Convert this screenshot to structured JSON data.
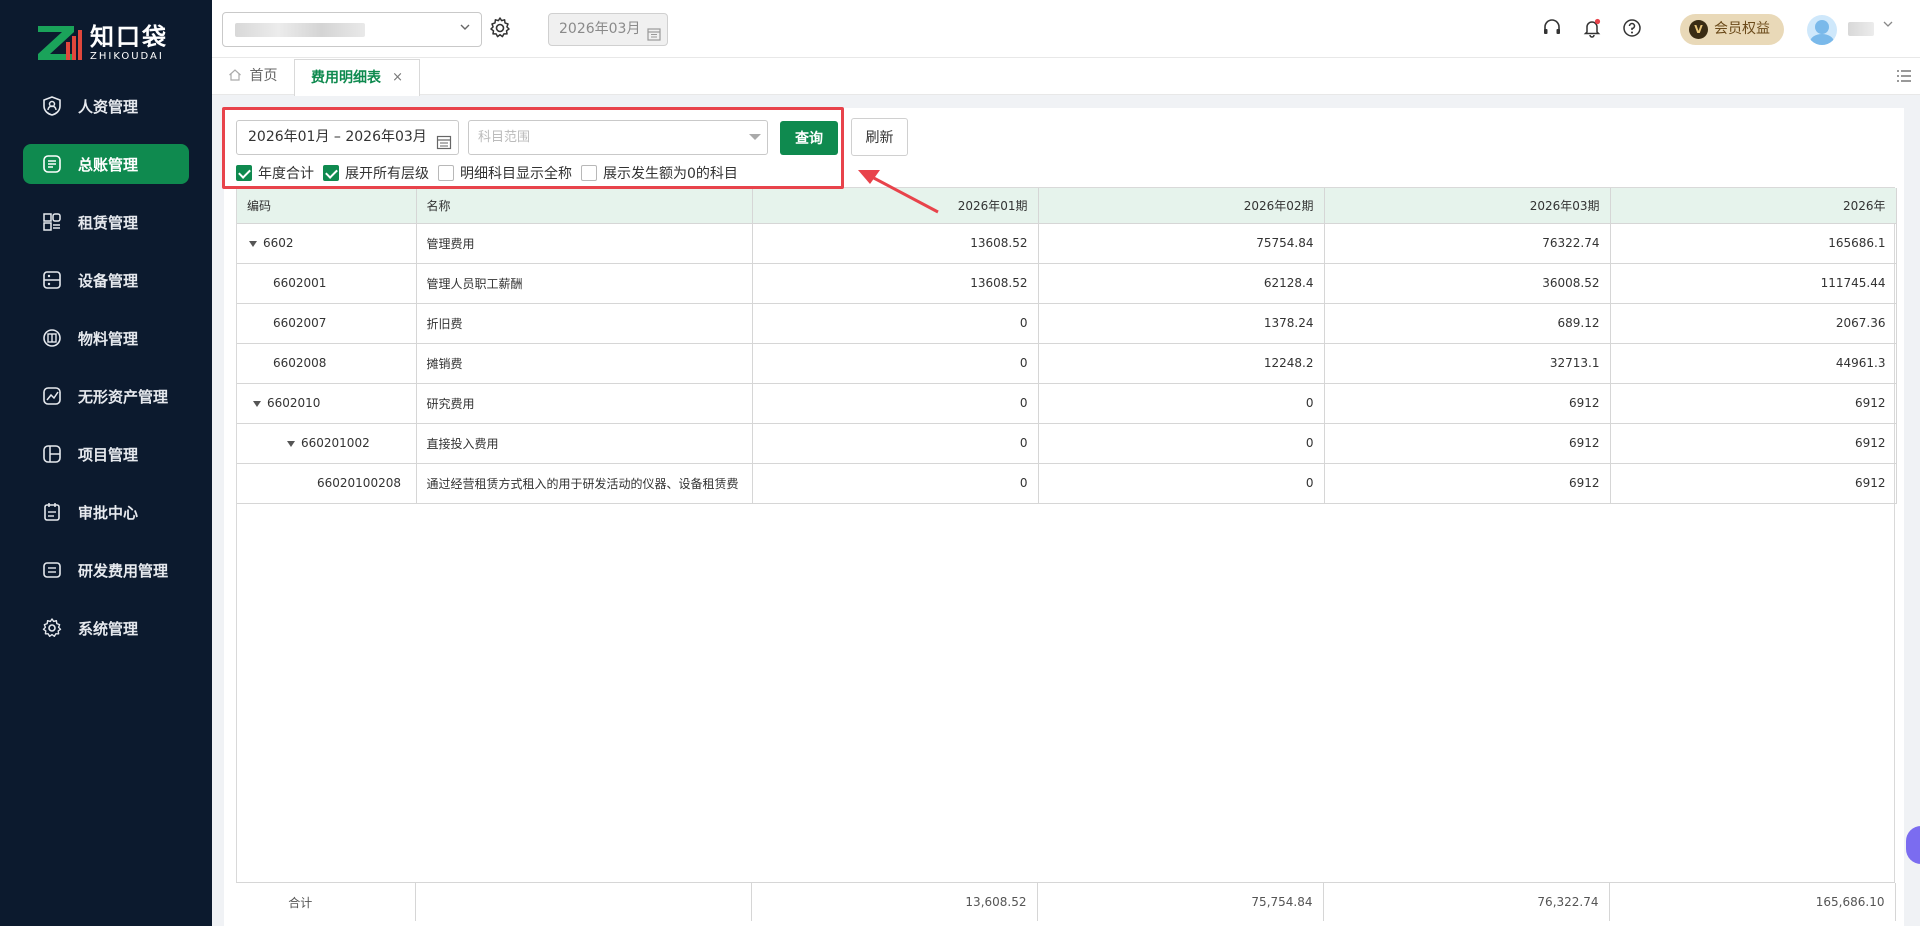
{
  "brand": {
    "name_cn": "知口袋",
    "name_en": "ZHIKOUDAI"
  },
  "sidebar": {
    "items": [
      {
        "label": "人资管理",
        "icon": "person-badge-icon",
        "active": false
      },
      {
        "label": "总账管理",
        "icon": "ledger-icon",
        "active": true
      },
      {
        "label": "租赁管理",
        "icon": "lease-icon",
        "active": false
      },
      {
        "label": "设备管理",
        "icon": "device-icon",
        "active": false
      },
      {
        "label": "物料管理",
        "icon": "material-icon",
        "active": false
      },
      {
        "label": "无形资产管理",
        "icon": "intangible-asset-icon",
        "active": false
      },
      {
        "label": "项目管理",
        "icon": "project-icon",
        "active": false
      },
      {
        "label": "审批中心",
        "icon": "approval-icon",
        "active": false
      },
      {
        "label": "研发费用管理",
        "icon": "rd-expense-icon",
        "active": false
      },
      {
        "label": "系统管理",
        "icon": "gear-icon",
        "active": false
      }
    ]
  },
  "header": {
    "current_month": "2026年03月",
    "vip_label": "会员权益",
    "vip_badge": "V"
  },
  "tabs": {
    "home": "首页",
    "active": "费用明细表",
    "close": "×"
  },
  "filter": {
    "date_range": "2026年01月 – 2026年03月",
    "subject_placeholder": "科目范围",
    "query_label": "查询",
    "refresh_label": "刷新",
    "checkboxes": [
      {
        "label": "年度合计",
        "checked": true
      },
      {
        "label": "展开所有层级",
        "checked": true
      },
      {
        "label": "明细科目显示全称",
        "checked": false
      },
      {
        "label": "展示发生额为0的科目",
        "checked": false
      }
    ]
  },
  "table": {
    "headers": [
      "编码",
      "名称",
      "2026年01期",
      "2026年02期",
      "2026年03期",
      "2026年"
    ],
    "rows": [
      {
        "code": "6602",
        "name": "管理费用",
        "m1": "13608.52",
        "m2": "75754.84",
        "m3": "76322.74",
        "year": "165686.1",
        "level": 0,
        "expand": true
      },
      {
        "code": "6602001",
        "name": "管理人员职工薪酬",
        "m1": "13608.52",
        "m2": "62128.4",
        "m3": "36008.52",
        "year": "111745.44",
        "level": 1,
        "expand": false
      },
      {
        "code": "6602007",
        "name": "折旧费",
        "m1": "0",
        "m2": "1378.24",
        "m3": "689.12",
        "year": "2067.36",
        "level": 1,
        "expand": false
      },
      {
        "code": "6602008",
        "name": "摊销费",
        "m1": "0",
        "m2": "12248.2",
        "m3": "32713.1",
        "year": "44961.3",
        "level": 1,
        "expand": false
      },
      {
        "code": "6602010",
        "name": "研究费用",
        "m1": "0",
        "m2": "0",
        "m3": "6912",
        "year": "6912",
        "level": 1,
        "expand": true
      },
      {
        "code": "660201002",
        "name": "直接投入费用",
        "m1": "0",
        "m2": "0",
        "m3": "6912",
        "year": "6912",
        "level": 2,
        "expand": true
      },
      {
        "code": "66020100208",
        "name": "通过经营租赁方式租入的用于研发活动的仪器、设备租赁费",
        "m1": "0",
        "m2": "0",
        "m3": "6912",
        "year": "6912",
        "level": 3,
        "expand": false
      }
    ],
    "footer": {
      "label": "合计",
      "m1": "13,608.52",
      "m2": "75,754.84",
      "m3": "76,322.74",
      "year": "165,686.10"
    }
  },
  "colors": {
    "brand_green": "#0f8a4f",
    "sidebar_bg": "#0c1a2e",
    "highlight_red": "#e8434b",
    "header_row": "#e6f3ec"
  }
}
